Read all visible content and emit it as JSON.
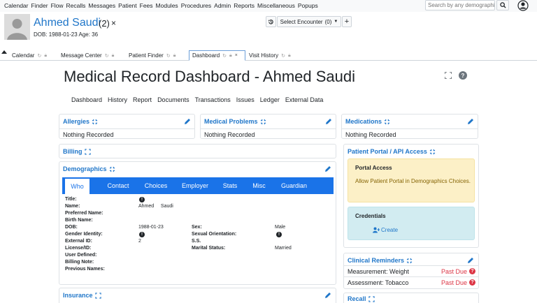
{
  "menu": {
    "items": [
      "Calendar",
      "Finder",
      "Flow",
      "Recalls",
      "Messages",
      "Patient",
      "Fees",
      "Modules",
      "Procedures",
      "Admin",
      "Reports",
      "Miscellaneous",
      "Popups"
    ],
    "search_placeholder": "Search by any demographics"
  },
  "patient": {
    "name": "Ahmed Saudi",
    "count": "(2)",
    "close": "×",
    "dob_age": "DOB: 1988-01-23 Age: 36",
    "encounter_label": "Select Encounter",
    "encounter_count": "(0)",
    "add": "+"
  },
  "tabs": [
    {
      "label": "Calendar",
      "active": false
    },
    {
      "label": "Message Center",
      "active": false
    },
    {
      "label": "Patient Finder",
      "active": false
    },
    {
      "label": "Dashboard",
      "active": true
    },
    {
      "label": "Visit History",
      "active": false
    }
  ],
  "dashboard": {
    "title": "Medical Record Dashboard - Ahmed Saudi",
    "subnav": [
      "Dashboard",
      "History",
      "Report",
      "Documents",
      "Transactions",
      "Issues",
      "Ledger",
      "External Data"
    ]
  },
  "cards": {
    "allergies": {
      "title": "Allergies",
      "body": "Nothing Recorded"
    },
    "medical_problems": {
      "title": "Medical Problems",
      "body": "Nothing Recorded"
    },
    "medications": {
      "title": "Medications",
      "body": "Nothing Recorded"
    },
    "billing": {
      "title": "Billing"
    },
    "insurance": {
      "title": "Insurance"
    },
    "recall": {
      "title": "Recall"
    }
  },
  "demographics": {
    "title": "Demographics",
    "tabs": [
      "Who",
      "Contact",
      "Choices",
      "Employer",
      "Stats",
      "Misc",
      "Guardian"
    ],
    "fields_left": [
      {
        "label": "Title:",
        "value": ""
      },
      {
        "label": "Name:",
        "value": "Ahmed     Saudi"
      },
      {
        "label": "Preferred Name:",
        "value": ""
      },
      {
        "label": "Birth Name:",
        "value": ""
      },
      {
        "label": "DOB:",
        "value": "1988-01-23"
      },
      {
        "label": "Gender Identity:",
        "value": ""
      },
      {
        "label": "External ID:",
        "value": "2"
      },
      {
        "label": "License/ID:",
        "value": ""
      },
      {
        "label": "User Defined:",
        "value": ""
      },
      {
        "label": "Billing Note:",
        "value": ""
      },
      {
        "label": "Previous Names:",
        "value": ""
      }
    ],
    "fields_right": [
      {
        "label": "Sex:",
        "value": "Male"
      },
      {
        "label": "Sexual Orientation:",
        "value": ""
      },
      {
        "label": "S.S.",
        "value": ""
      },
      {
        "label": "Marital Status:",
        "value": "Married"
      }
    ]
  },
  "portal": {
    "title": "Patient Portal / API Access",
    "access_title": "Portal Access",
    "access_text": "Allow Patient Portal in Demographics Choices.",
    "credentials_title": "Credentials",
    "create_label": "Create"
  },
  "reminders": {
    "title": "Clinical Reminders",
    "items": [
      {
        "label": "Measurement: Weight",
        "status": "Past Due"
      },
      {
        "label": "Assessment: Tobacco",
        "status": "Past Due"
      }
    ]
  },
  "colors": {
    "link": "#1f76c9",
    "tab_bar": "#1a73e8",
    "past_due": "#dc3545",
    "portal_access_bg": "#fcf0c7",
    "credentials_bg": "#d2ecf1"
  }
}
